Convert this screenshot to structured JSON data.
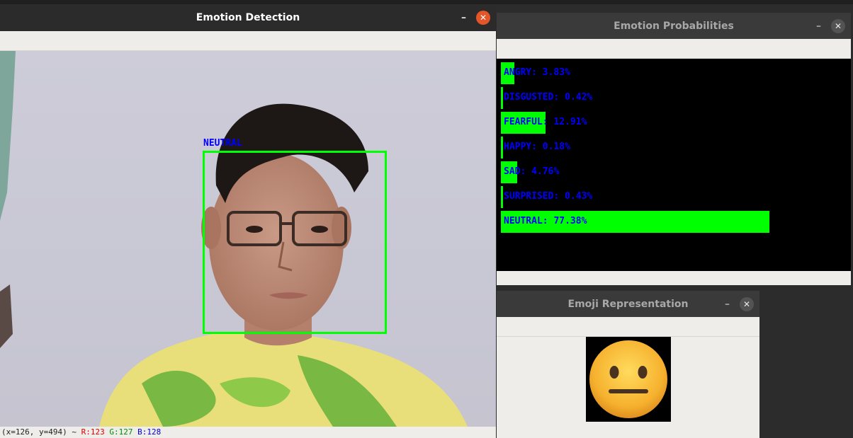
{
  "detection_window": {
    "title": "Emotion Detection",
    "minimize_label": "–",
    "close_label": "✕",
    "face_label": "NEUTRAL",
    "status": {
      "coords": "(x=126, y=494) ~",
      "r": "R:123",
      "g": "G:127",
      "b": "B:128"
    },
    "colors": {
      "box": "#00ff00",
      "label": "#0000ff",
      "close": "#e4562a"
    }
  },
  "probabilities_window": {
    "title": "Emotion Probabilities",
    "minimize_label": "–",
    "close_label": "✕",
    "rows": [
      {
        "label": "ANGRY: 3.83%",
        "value": 3.83
      },
      {
        "label": "DISGUSTED: 0.42%",
        "value": 0.42
      },
      {
        "label": "FEARFUL: 12.91%",
        "value": 12.91
      },
      {
        "label": "HAPPY: 0.18%",
        "value": 0.18
      },
      {
        "label": "SAD: 4.76%",
        "value": 4.76
      },
      {
        "label": "SURPRISED: 0.43%",
        "value": 0.43
      },
      {
        "label": "NEUTRAL: 77.38%",
        "value": 77.38
      }
    ],
    "colors": {
      "bar": "#00ff00",
      "text": "#0000ff",
      "background": "#000000"
    }
  },
  "emoji_window": {
    "title": "Emoji Representation",
    "minimize_label": "–",
    "close_label": "✕",
    "emoji_icon": "neutral-face-icon"
  }
}
